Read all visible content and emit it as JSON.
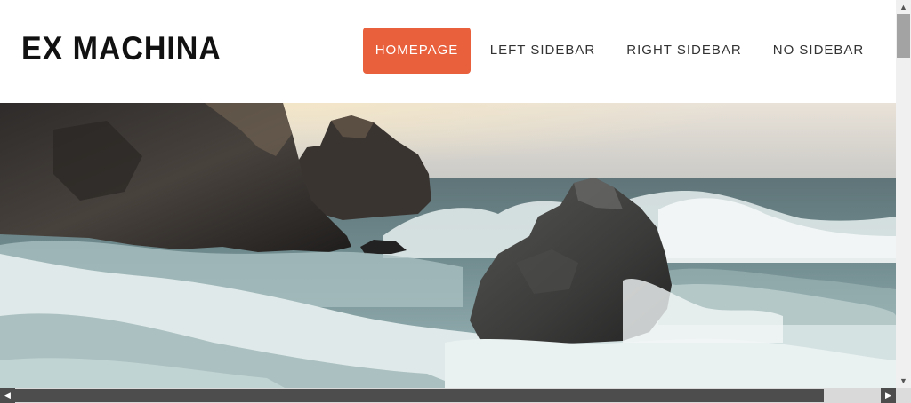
{
  "site": {
    "logo": "EX MACHINA"
  },
  "nav": {
    "items": [
      {
        "label": "HOMEPAGE",
        "active": true
      },
      {
        "label": "LEFT SIDEBAR",
        "active": false
      },
      {
        "label": "RIGHT SIDEBAR",
        "active": false
      },
      {
        "label": "NO SIDEBAR",
        "active": false
      }
    ]
  },
  "hero": {
    "image": "ocean waves crashing on sea rocks"
  },
  "colors": {
    "accent": "#e8603c",
    "top_strip": "#3b6fb0",
    "text_dark": "#111111",
    "nav_text": "#333333"
  },
  "scrollbars": {
    "vertical": {
      "up_icon": "chevron-up-icon",
      "down_icon": "chevron-down-icon"
    },
    "horizontal": {
      "left_icon": "chevron-left-icon",
      "right_icon": "chevron-right-icon"
    }
  }
}
